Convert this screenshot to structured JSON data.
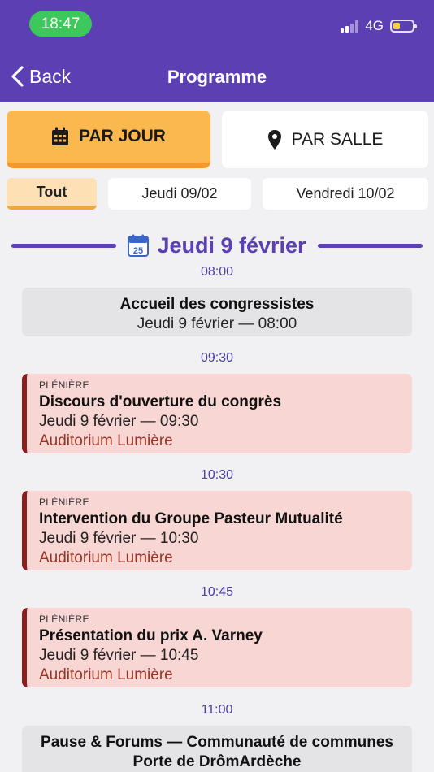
{
  "status_bar": {
    "time": "18:47",
    "network": "4G"
  },
  "nav": {
    "back_label": "Back",
    "title": "Programme"
  },
  "view_toggle": {
    "by_day": "PAR JOUR",
    "by_room": "PAR SALLE"
  },
  "filters": [
    "Tout",
    "Jeudi 09/02",
    "Vendredi 10/02"
  ],
  "day_heading": {
    "label": "Jeudi 9 février",
    "icon_day": "25"
  },
  "times": [
    "08:00",
    "09:30",
    "10:30",
    "10:45",
    "11:00"
  ],
  "events": [
    {
      "title": "Accueil des congressistes",
      "date": "Jeudi 9 février — 08:00"
    },
    {
      "kind": "PLÉNIÈRE",
      "title": "Discours d'ouverture du congrès",
      "date": "Jeudi 9 février — 09:30",
      "room": "Auditorium Lumière"
    },
    {
      "kind": "PLÉNIÈRE",
      "title": "Intervention du Groupe Pasteur Mutualité",
      "date": "Jeudi 9 février — 10:30",
      "room": "Auditorium Lumière"
    },
    {
      "kind": "PLÉNIÈRE",
      "title": "Présentation du prix A. Varney",
      "date": "Jeudi 9 février — 10:45",
      "room": "Auditorium Lumière"
    },
    {
      "title_line1": "Pause & Forums — Communauté de communes",
      "title_line2": "Porte de DrômArdèche"
    }
  ],
  "colors": {
    "brand": "#5b3fb3",
    "accent": "#fbb84e",
    "plenary_bg": "#f7d6d3",
    "plenary_bar": "#8e1d1d"
  }
}
